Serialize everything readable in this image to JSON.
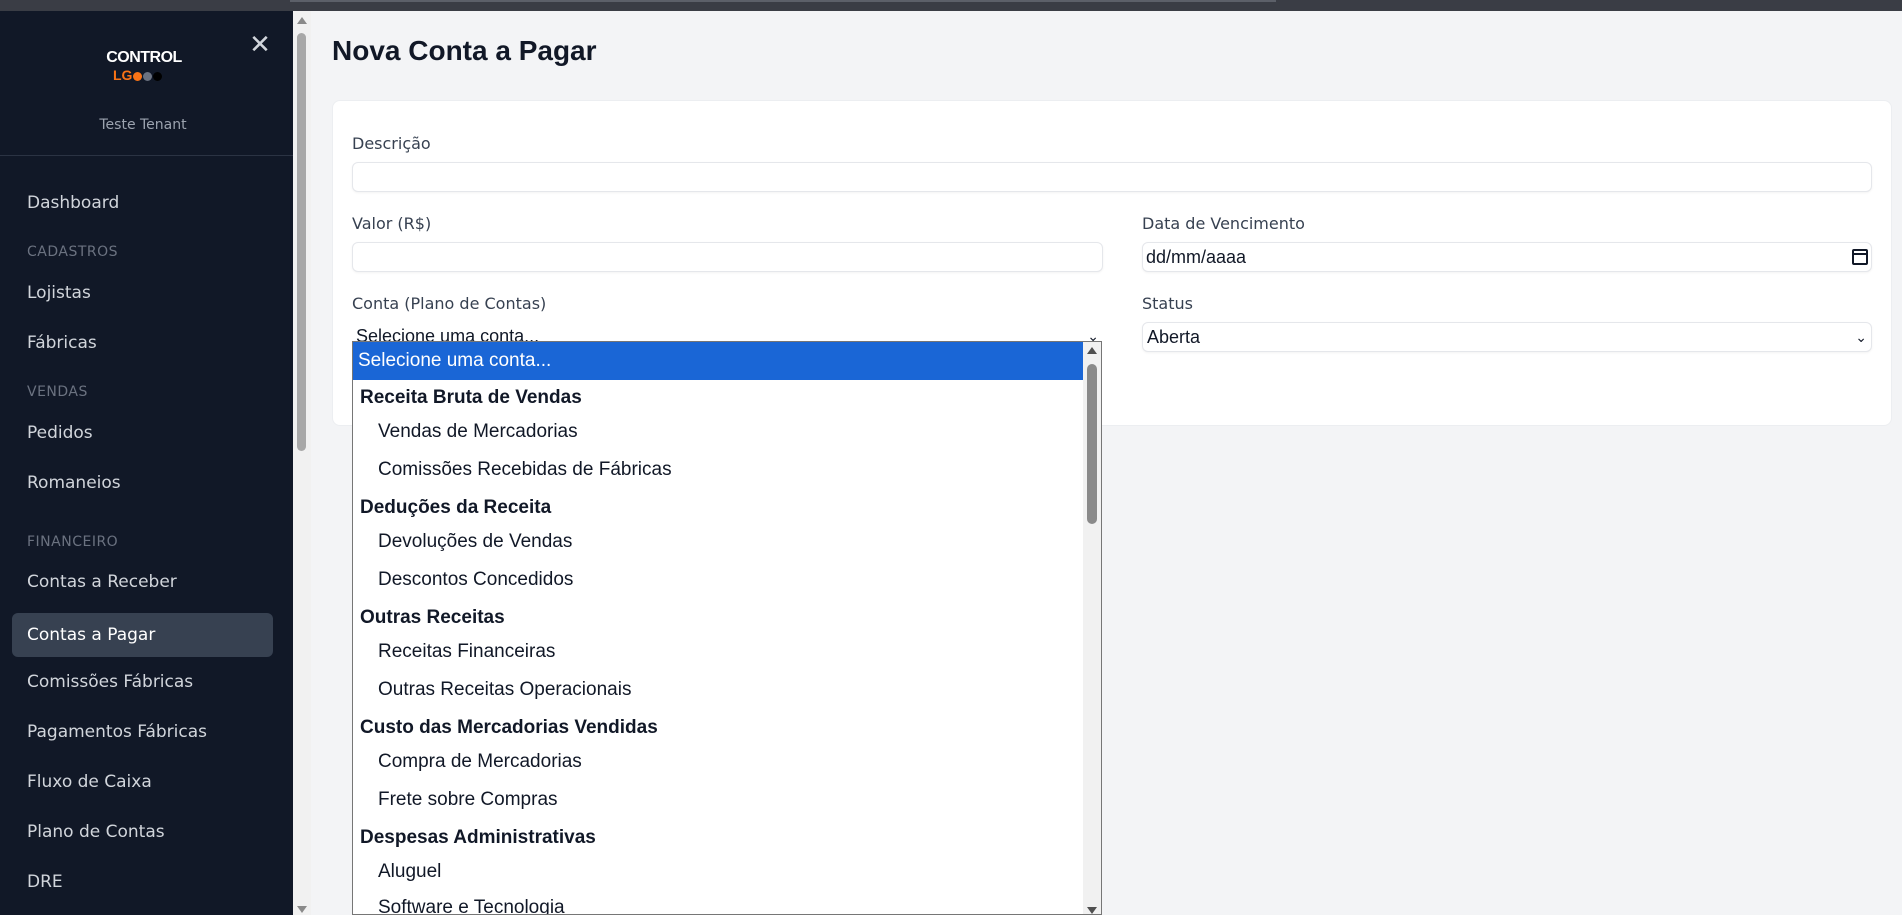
{
  "sidebar": {
    "logo": {
      "line1": "CONTROL",
      "line2": "LG"
    },
    "tenant": "Teste Tenant",
    "close_icon": "close-icon",
    "nav": {
      "dashboard": "Dashboard",
      "section_cadastros": "CADASTROS",
      "lojistas": "Lojistas",
      "fabricas": "Fábricas",
      "section_vendas": "VENDAS",
      "pedidos": "Pedidos",
      "romaneios": "Romaneios",
      "section_financeiro": "FINANCEIRO",
      "contas_receber": "Contas a Receber",
      "contas_pagar": "Contas a Pagar",
      "comissoes_fabricas": "Comissões Fábricas",
      "pagamentos_fabricas": "Pagamentos Fábricas",
      "fluxo_caixa": "Fluxo de Caixa",
      "plano_contas": "Plano de Contas",
      "dre": "DRE"
    },
    "active_item": "Contas a Pagar"
  },
  "colors": {
    "sidebar_bg": "#111827",
    "active_bg": "#374151",
    "option_highlight": "#1a66d6",
    "logo_accent": "#f97316"
  },
  "form": {
    "title": "Nova Conta a Pagar",
    "descricao_label": "Descrição",
    "descricao_value": "",
    "valor_label": "Valor (R$)",
    "valor_value": "",
    "vencimento_label": "Data de Vencimento",
    "vencimento_placeholder": "dd/mm/aaaa",
    "conta_label": "Conta (Plano de Contas)",
    "conta_value": "Selecione uma conta...",
    "status_label": "Status",
    "status_value": "Aberta"
  },
  "dropdown": {
    "selected": "Selecione uma conta...",
    "options": [
      {
        "label": "Receita Bruta de Vendas",
        "kind": "group"
      },
      {
        "label": "Vendas de Mercadorias",
        "kind": "child"
      },
      {
        "label": "Comissões Recebidas de Fábricas",
        "kind": "child"
      },
      {
        "label": "Deduções da Receita",
        "kind": "group"
      },
      {
        "label": "Devoluções de Vendas",
        "kind": "child"
      },
      {
        "label": "Descontos Concedidos",
        "kind": "child"
      },
      {
        "label": "Outras Receitas",
        "kind": "group"
      },
      {
        "label": "Receitas Financeiras",
        "kind": "child"
      },
      {
        "label": "Outras Receitas Operacionais",
        "kind": "child"
      },
      {
        "label": "Custo das Mercadorias Vendidas",
        "kind": "group"
      },
      {
        "label": "Compra de Mercadorias",
        "kind": "child"
      },
      {
        "label": "Frete sobre Compras",
        "kind": "child"
      },
      {
        "label": "Despesas Administrativas",
        "kind": "group"
      },
      {
        "label": "Aluguel",
        "kind": "child"
      },
      {
        "label": "Software e Tecnologia",
        "kind": "child"
      }
    ]
  }
}
